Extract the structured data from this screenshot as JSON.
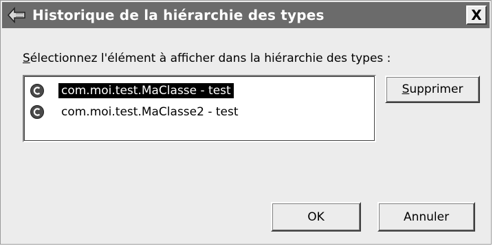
{
  "window": {
    "title": "Historique de la hiérarchie des types",
    "close_glyph": "X",
    "icon": "type-hierarchy-icon"
  },
  "prompt": {
    "mnemonic": "S",
    "rest": "électionnez l'élément à afficher dans la hiérarchie des types :"
  },
  "list": {
    "items": [
      {
        "label": "com.moi.test.MaClasse - test",
        "icon": "class-icon",
        "selected": true
      },
      {
        "label": "com.moi.test.MaClasse2 - test",
        "icon": "class-icon",
        "selected": false
      }
    ]
  },
  "buttons": {
    "remove": {
      "mnemonic": "S",
      "rest": "upprimer"
    },
    "ok": "OK",
    "cancel": "Annuler"
  },
  "colors": {
    "titlebar": "#6b6b6b",
    "dialog_bg": "#ececec",
    "selection_bg": "#000000",
    "selection_fg": "#ffffff"
  }
}
